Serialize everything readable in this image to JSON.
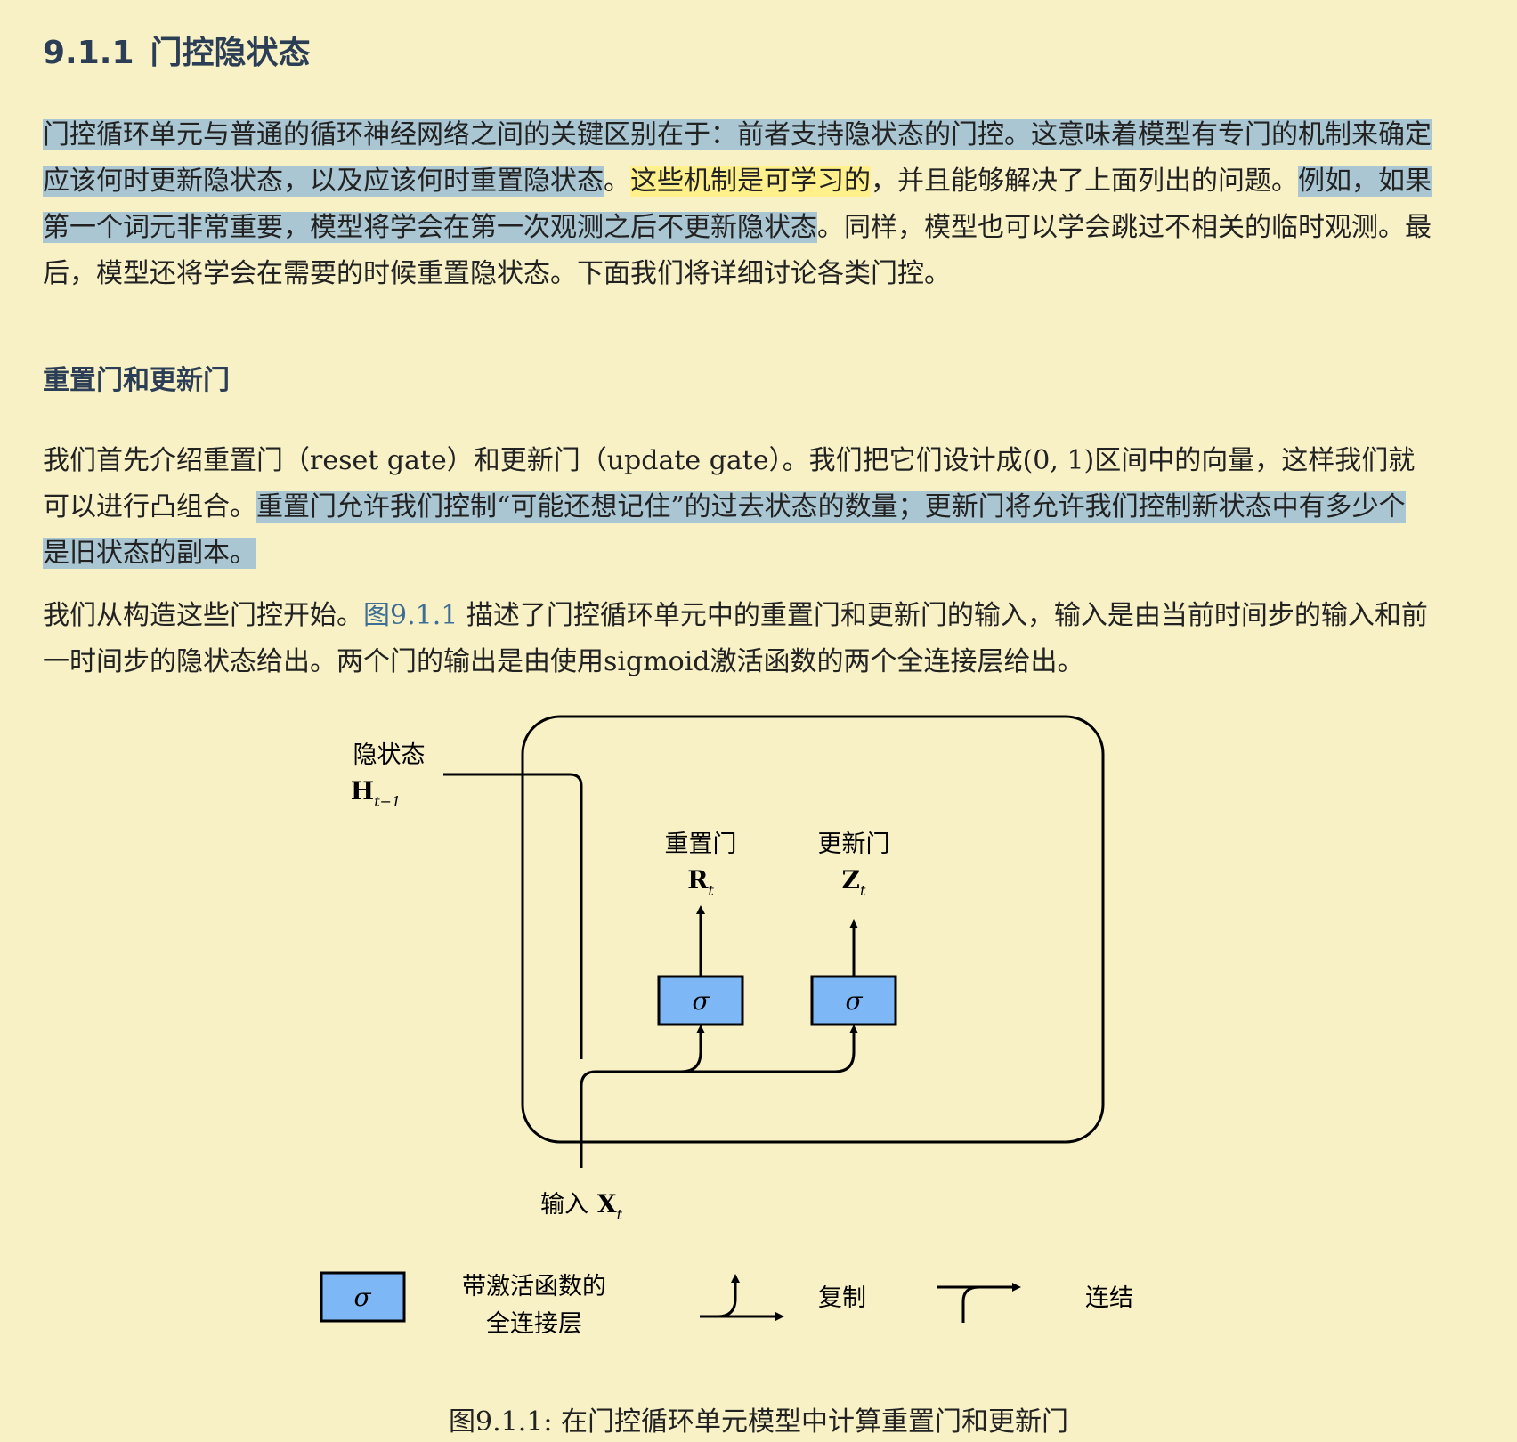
{
  "section": {
    "number": "9.1.1",
    "title": "门控隐状态"
  },
  "para1": {
    "s1": "门控循环单元与普通的循环神经网络之间的关键区别在于：前者支持隐状态的门控。这意味着模型有专门的机制来确定应该何时更新隐状态，以及应该何时重置隐状态",
    "s2": "。",
    "s3": "这些机制是可学习的",
    "s4": "，并且能够解决了上面列出的问题。",
    "s5": "例如，如果第一个词元非常重要，模型将学会在第一次观测之后不更新隐状态",
    "s6": "。同样，模型也可以学会跳过不相关的临时观测。最后，模型还将学会在需要的时候重置隐状态。下面我们将详细讨论各类门控。"
  },
  "subsection": {
    "title": "重置门和更新门"
  },
  "para2": {
    "s1": "我们首先介绍重置门（reset gate）和更新门（update gate）。我们把它们设计成(0, 1)区间中的向量，这样我们就可以进行凸组合。",
    "s2": "重置门允许我们控制“可能还想记住”的过去状态的数量；更新门将允许我们控制新状态中有多少个是旧状态的副本。"
  },
  "para3": {
    "s1": "我们从构造这些门控开始。",
    "ref": "图9.1.1",
    "s2": " 描述了门控循环单元中的重置门和更新门的输入，输入是由当前时间步的输入和前一时间步的隐状态给出。两个门的输出是由使用sigmoid激活函数的两个全连接层给出。"
  },
  "diagram": {
    "hidden_label": "隐状态",
    "hidden_symbol": "H",
    "hidden_sub": "t−1",
    "reset_label": "重置门",
    "reset_symbol": "R",
    "reset_sub": "t",
    "update_label": "更新门",
    "update_symbol": "Z",
    "update_sub": "t",
    "sigma": "σ",
    "input_label": "输入",
    "input_symbol": "X",
    "input_sub": "t",
    "legend_fc_line1": "带激活函数的",
    "legend_fc_line2": "全连接层",
    "legend_copy": "复制",
    "legend_concat": "连结",
    "box_color": "#7eb7f5"
  },
  "caption": "图9.1.1: 在门控循环单元模型中计算重置门和更新门"
}
